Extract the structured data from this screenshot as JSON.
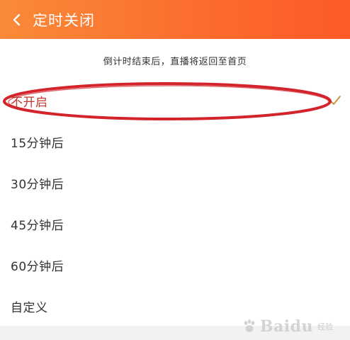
{
  "header": {
    "title": "定时关闭",
    "back_icon": "chevron-left-icon"
  },
  "hint": {
    "text": "倒计时结束后，直播将返回至首页"
  },
  "options": [
    {
      "label": "不开启",
      "selected": true
    },
    {
      "label": "15分钟后",
      "selected": false
    },
    {
      "label": "30分钟后",
      "selected": false
    },
    {
      "label": "45分钟后",
      "selected": false
    },
    {
      "label": "60分钟后",
      "selected": false
    },
    {
      "label": "自定义",
      "selected": false
    }
  ],
  "colors": {
    "header_start": "#f98a38",
    "header_end": "#fd5a28",
    "check": "#c79a3a",
    "annotation": "#d3242b"
  },
  "watermark": {
    "brand": "Baidu",
    "sub": "经验"
  }
}
